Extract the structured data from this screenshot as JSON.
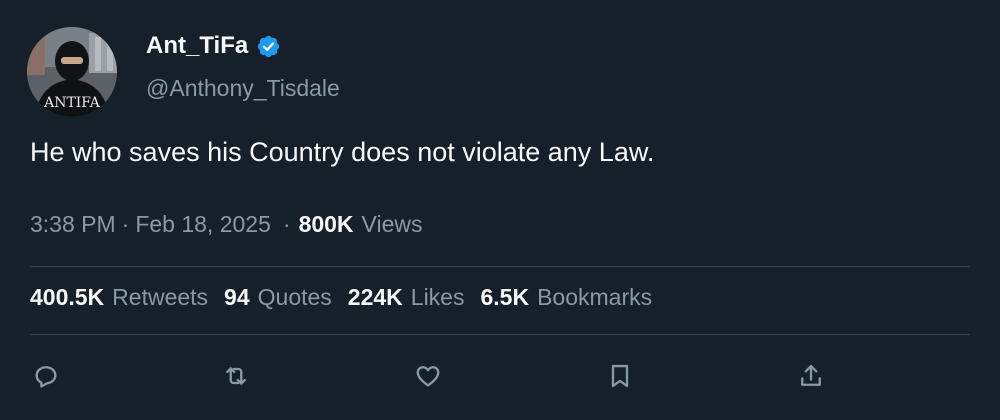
{
  "author": {
    "display_name": "Ant_TiFa",
    "handle": "@Anthony_Tisdale",
    "verified": true,
    "avatar_text": "ANTIFA"
  },
  "tweet": {
    "text": "He who saves his Country does not violate any Law."
  },
  "meta": {
    "time": "3:38 PM",
    "separator": "·",
    "date": "Feb 18, 2025",
    "dot": "·",
    "views_count": "800K",
    "views_label": "Views"
  },
  "stats": [
    {
      "count": "400.5K",
      "label": "Retweets"
    },
    {
      "count": "94",
      "label": "Quotes"
    },
    {
      "count": "224K",
      "label": "Likes"
    },
    {
      "count": "6.5K",
      "label": "Bookmarks"
    }
  ],
  "actions": [
    {
      "icon": "reply-icon"
    },
    {
      "icon": "retweet-icon"
    },
    {
      "icon": "like-icon"
    },
    {
      "icon": "bookmark-icon"
    },
    {
      "icon": "share-icon"
    }
  ],
  "colors": {
    "background": "#15202b",
    "text_primary": "#f7f9f9",
    "text_secondary": "#8b98a5",
    "verified_badge": "#1d9bf0",
    "divider": "#38444d"
  }
}
